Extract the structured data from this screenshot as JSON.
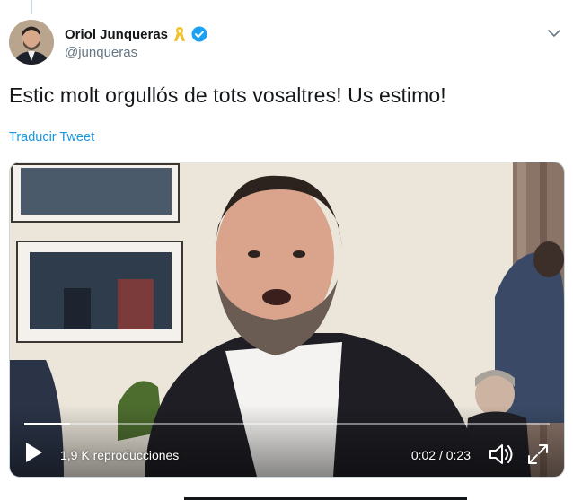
{
  "tweet": {
    "author_name": "Oriol Junqueras",
    "handle": "@junqueras",
    "text": "Estic molt orgullós de tots vosaltres! Us estimo!",
    "translate_label": "Traducir Tweet"
  },
  "video": {
    "views_label": "1,9 K reproducciones",
    "time_label": "0:02 / 0:23",
    "progress_fraction": 0.087
  },
  "icons": {
    "ribbon": "yellow-ribbon-icon",
    "verified": "verified-badge-icon",
    "caret": "chevron-down-icon",
    "play": "play-icon",
    "volume": "volume-icon",
    "fullscreen": "fullscreen-icon"
  },
  "colors": {
    "link": "#1b95e0",
    "verified": "#1da1f2",
    "ribbon": "#f2c12e",
    "handle": "#657786"
  }
}
